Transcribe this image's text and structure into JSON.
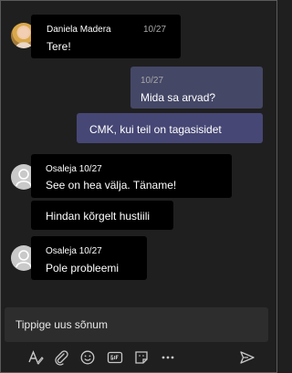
{
  "messages": [
    {
      "sender": "Daniela Madera",
      "time": "10/27",
      "text": "Tere!"
    },
    {
      "time": "10/27",
      "text": "Mida sa arvad?"
    },
    {
      "text": "CMK, kui teil on tagasisidet"
    },
    {
      "sender": "Osaleja",
      "time": "10/27",
      "text": "See on hea välja. Täname!"
    },
    {
      "text": "Hindan kõrgelt hustiili"
    },
    {
      "sender": "Osaleja",
      "time": "10/27",
      "text": "Pole probleemi"
    }
  ],
  "composer": {
    "placeholder": "Tippige uus sõnum"
  },
  "toolbar": {
    "icons": [
      "format-icon",
      "attach-icon",
      "emoji-icon",
      "gif-icon",
      "sticker-icon",
      "more-icon",
      "send-icon"
    ]
  },
  "colors": {
    "background": "#1f1f1f",
    "incoming_bubble": "#000000",
    "outgoing_bubble": "#444766",
    "composer": "#2d2d2d"
  }
}
